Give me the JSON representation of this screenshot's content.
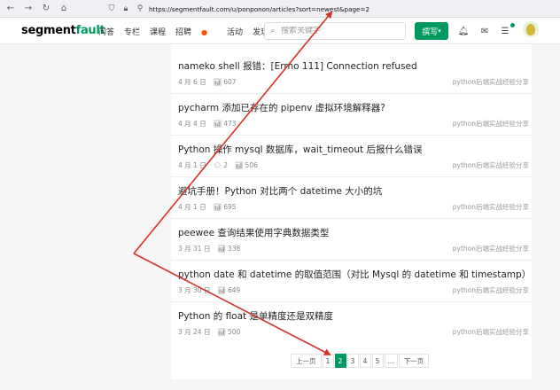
{
  "browser": {
    "url": "https://segmentfault.com/u/ponponon/articles?sort=newest&page=2"
  },
  "header": {
    "logo_main": "segment",
    "logo_accent": "fault",
    "nav": [
      "问答",
      "专栏",
      "课程",
      "招聘",
      "活动",
      "发现"
    ],
    "search_placeholder": "搜索关键字",
    "write_label": "撰写"
  },
  "articles": [
    {
      "title": "nameko shell 报错：[Errno 111] Connection refused",
      "date": "4 月 6 日",
      "comments": "",
      "views": "607",
      "tag": "python后端实战经验分享"
    },
    {
      "title": "pycharm 添加已存在的 pipenv 虚拟环境解释器?",
      "date": "4 月 4 日",
      "comments": "",
      "views": "473",
      "tag": "python后端实战经验分享"
    },
    {
      "title": "Python 操作 mysql 数据库，wait_timeout 后报什么错误",
      "date": "4 月 1 日",
      "comments": "2",
      "views": "506",
      "tag": "python后端实战经验分享"
    },
    {
      "title": "避坑手册！Python 对比两个 datetime 大小的坑",
      "date": "4 月 1 日",
      "comments": "",
      "views": "695",
      "tag": "python后端实战经验分享"
    },
    {
      "title": "peewee 查询结果使用字典数据类型",
      "date": "3 月 31 日",
      "comments": "",
      "views": "338",
      "tag": "python后端实战经验分享"
    },
    {
      "title": "python date 和 datetime 的取值范围（对比 Mysql 的 datetime 和 timestamp）",
      "date": "3 月 30 日",
      "comments": "",
      "views": "649",
      "tag": "python后端实战经验分享"
    },
    {
      "title": "Python 的 float 是单精度还是双精度",
      "date": "3 月 24 日",
      "comments": "",
      "views": "500",
      "tag": "python后端实战经验分享"
    }
  ],
  "pagination": {
    "prev": "上一页",
    "pages": [
      "1",
      "2",
      "3",
      "4",
      "5",
      "..."
    ],
    "active": "2",
    "next": "下一页"
  },
  "annotation_color": "#d93025",
  "accent_color": "#009a61"
}
